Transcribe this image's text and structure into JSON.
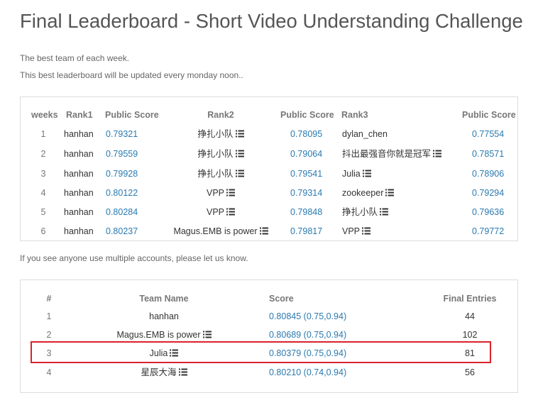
{
  "page": {
    "title": "Final Leaderboard - Short Video Understanding Challenge",
    "note_best_team": "The best team of each week.",
    "note_update": "This best leaderboard will be updated every monday noon..",
    "note_accounts": "If you see anyone use multiple accounts, please let us know."
  },
  "weekly": {
    "headers": [
      "weeks",
      "Rank1",
      "Public Score",
      "Rank2",
      "Public Score",
      "Rank3",
      "Public Score"
    ],
    "rows": [
      {
        "week": "1",
        "rank1": "hanhan",
        "score1": "0.79321",
        "rank2": "挣扎小队",
        "score2": "0.78095",
        "rank3": "dylan_chen",
        "score3": "0.77554"
      },
      {
        "week": "2",
        "rank1": "hanhan",
        "score1": "0.79559",
        "rank2": "挣扎小队",
        "score2": "0.79064",
        "rank3": "抖出最强音你就是冠军",
        "score3": "0.78571"
      },
      {
        "week": "3",
        "rank1": "hanhan",
        "score1": "0.79928",
        "rank2": "挣扎小队",
        "score2": "0.79541",
        "rank3": "Julia",
        "score3": "0.78906"
      },
      {
        "week": "4",
        "rank1": "hanhan",
        "score1": "0.80122",
        "rank2": "VPP",
        "score2": "0.79314",
        "rank3": "zookeeper",
        "score3": "0.79294"
      },
      {
        "week": "5",
        "rank1": "hanhan",
        "score1": "0.80284",
        "rank2": "VPP",
        "score2": "0.79848",
        "rank3": "挣扎小队",
        "score3": "0.79636"
      },
      {
        "week": "6",
        "rank1": "hanhan",
        "score1": "0.80237",
        "rank2": "Magus.EMB is power",
        "score2": "0.79817",
        "rank3": "VPP",
        "score3": "0.79772"
      }
    ]
  },
  "final": {
    "headers": [
      "#",
      "Team Name",
      "Score",
      "Final Entries"
    ],
    "rows": [
      {
        "rank": "1",
        "team": "hanhan",
        "score": "0.80845 (0.75,0.94)",
        "entries": "44"
      },
      {
        "rank": "2",
        "team": "Magus.EMB is power",
        "score": "0.80689 (0.75,0.94)",
        "entries": "102"
      },
      {
        "rank": "3",
        "team": "Julia",
        "score": "0.80379 (0.75,0.94)",
        "entries": "81"
      },
      {
        "rank": "4",
        "team": "星辰大海",
        "score": "0.80210 (0.74,0.94)",
        "entries": "56"
      }
    ]
  },
  "colors": {
    "link": "#2a7ab0",
    "text": "#333333",
    "header": "#777777",
    "highlight": "#d9232d"
  },
  "icons": {
    "team_list": "list-icon"
  }
}
